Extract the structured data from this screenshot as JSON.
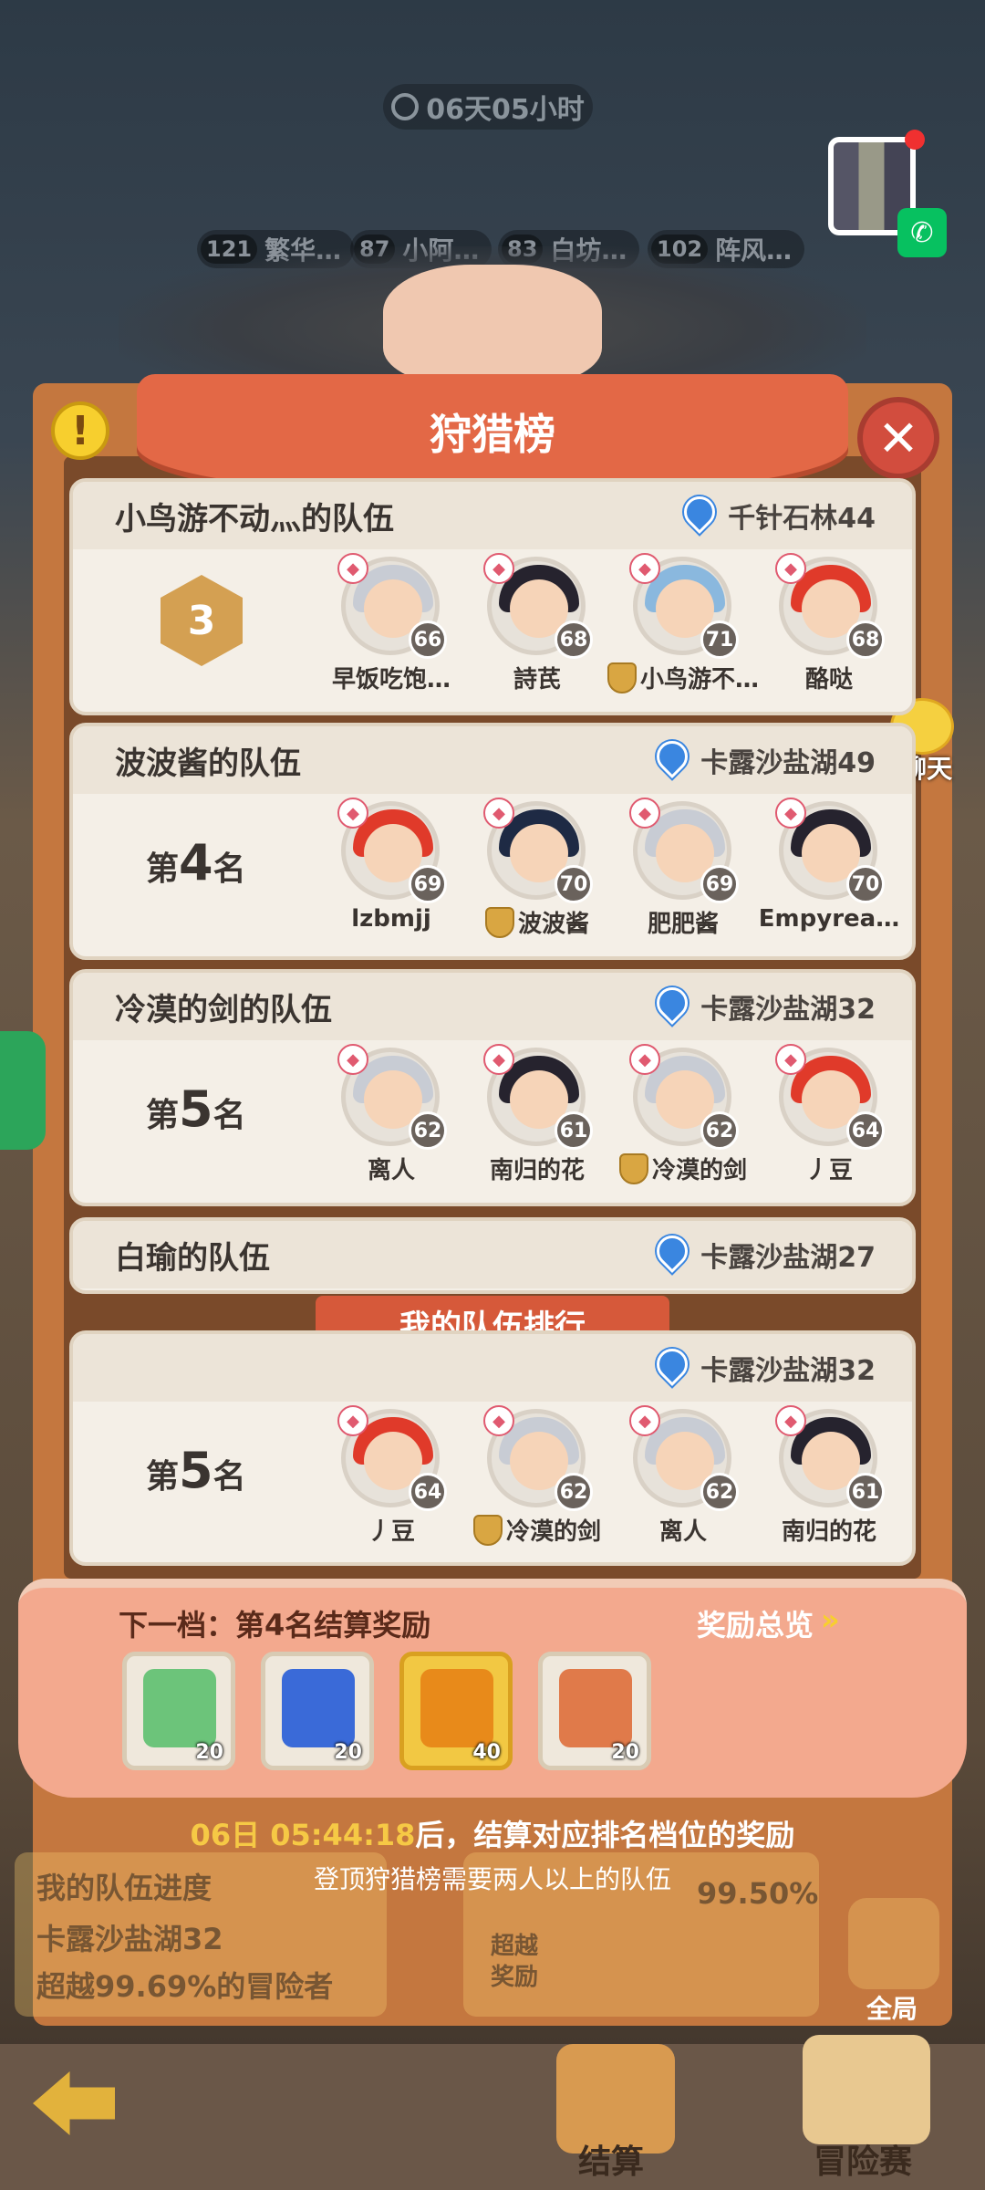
{
  "timer": "06天05小时",
  "bg_names": [
    {
      "level": "121",
      "name": "繁华…"
    },
    {
      "level": "87",
      "name": "小阿…"
    },
    {
      "level": "83",
      "name": "白坊…"
    },
    {
      "level": "102",
      "name": "阵风…"
    }
  ],
  "title": "狩猎榜",
  "chat_label": "聊天",
  "teams": [
    {
      "name": "小鸟游不动灬的队伍",
      "location": "千针石林44",
      "rank_medal": "3",
      "heroes": [
        {
          "name": "早饭吃饱…",
          "level": "66",
          "hair": "#c8ccd4",
          "leader": false
        },
        {
          "name": "詩芪",
          "level": "68",
          "hair": "#26232e",
          "leader": false
        },
        {
          "name": "小鸟游不…",
          "level": "71",
          "hair": "#8ab8de",
          "leader": true
        },
        {
          "name": "酪哒",
          "level": "68",
          "hair": "#e03a2a",
          "leader": false
        }
      ]
    },
    {
      "name": "波波酱的队伍",
      "location": "卡露沙盐湖49",
      "rank_prefix": "第",
      "rank_num": "4",
      "rank_suffix": "名",
      "heroes": [
        {
          "name": "lzbmjj",
          "level": "69",
          "hair": "#e03a2a",
          "leader": false
        },
        {
          "name": "波波酱",
          "level": "70",
          "hair": "#1e2a44",
          "leader": true
        },
        {
          "name": "肥肥酱",
          "level": "69",
          "hair": "#c8ccd4",
          "leader": false
        },
        {
          "name": "Empyrea…",
          "level": "70",
          "hair": "#26232e",
          "leader": false
        }
      ]
    },
    {
      "name": "冷漠的剑的队伍",
      "location": "卡露沙盐湖32",
      "rank_prefix": "第",
      "rank_num": "5",
      "rank_suffix": "名",
      "heroes": [
        {
          "name": "离人",
          "level": "62",
          "hair": "#c8ccd4",
          "leader": false
        },
        {
          "name": "南归的花",
          "level": "61",
          "hair": "#26232e",
          "leader": false
        },
        {
          "name": "冷漠的剑",
          "level": "62",
          "hair": "#c8ccd4",
          "leader": true
        },
        {
          "name": "丿豆",
          "level": "64",
          "hair": "#e03a2a",
          "leader": false
        }
      ]
    },
    {
      "name": "白瑜的队伍",
      "location": "卡露沙盐湖27"
    }
  ],
  "my_team_tab": "我的队伍排行",
  "my_team": {
    "location": "卡露沙盐湖32",
    "rank_prefix": "第",
    "rank_num": "5",
    "rank_suffix": "名",
    "heroes": [
      {
        "name": "丿豆",
        "level": "64",
        "hair": "#e03a2a",
        "leader": false
      },
      {
        "name": "冷漠的剑",
        "level": "62",
        "hair": "#c8ccd4",
        "leader": true
      },
      {
        "name": "离人",
        "level": "62",
        "hair": "#c8ccd4",
        "leader": false
      },
      {
        "name": "南归的花",
        "level": "61",
        "hair": "#26232e",
        "leader": false
      }
    ]
  },
  "next_tier": "下一档：第4名结算奖励",
  "reward_overview": "奖励总览",
  "rewards": [
    {
      "icon": "green-ticket-icon",
      "count": "20",
      "color": "#6cc47a"
    },
    {
      "icon": "blue-crystal-icon",
      "count": "20",
      "color": "#3a6ad8"
    },
    {
      "icon": "golden-egg-icon",
      "count": "40",
      "color": "#e88a1a"
    },
    {
      "icon": "food-plate-icon",
      "count": "20",
      "color": "#e07a4a"
    }
  ],
  "settle_time": "06日 05:44:18",
  "settle_text": "后，结算对应排名档位的奖励",
  "need_text": "登顶狩猎榜需要两人以上的队伍",
  "bg_progress": {
    "title": "我的队伍进度",
    "location": "卡露沙盐湖32",
    "exceed": "超越99.69%的冒险者",
    "pct": "99.50%",
    "exceed_label": "超越\n奖励",
    "global": "全局"
  },
  "bottom_tabs": {
    "settle": "结算",
    "adventure": "冒险赛"
  }
}
